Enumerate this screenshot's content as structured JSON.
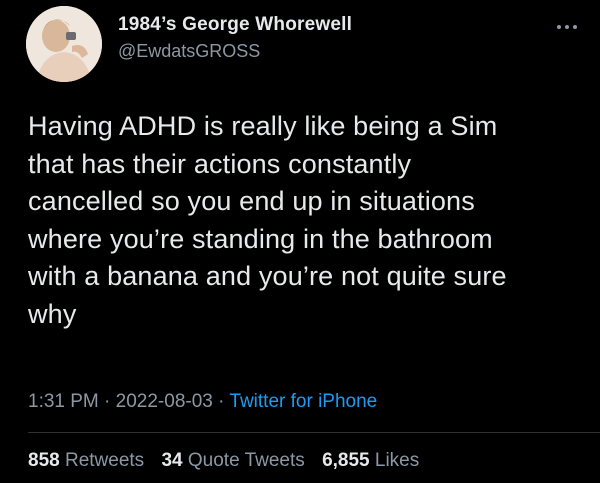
{
  "author": {
    "display_name": "1984’s George Whorewell",
    "handle": "@EwdatsGROSS"
  },
  "more_icon": "more-horizontal-icon",
  "tweet": {
    "text": "Having ADHD is really like being a Sim\nthat has their actions constantly\ncancelled so you end up in situations\nwhere you’re standing in the bathroom\nwith a banana and you’re not quite sure\nwhy"
  },
  "meta": {
    "time": "1:31 PM",
    "separator": " · ",
    "date": "2022-08-03",
    "source": "Twitter for iPhone"
  },
  "stats": {
    "retweets_count": "858",
    "retweets_label": "Retweets",
    "quotes_count": "34",
    "quotes_label": "Quote Tweets",
    "likes_count": "6,855",
    "likes_label": "Likes"
  },
  "colors": {
    "background": "#000000",
    "primary_text": "#e7e9ea",
    "secondary_text": "#8b98a5",
    "link": "#1d9bf0",
    "divider": "#2f3336"
  }
}
